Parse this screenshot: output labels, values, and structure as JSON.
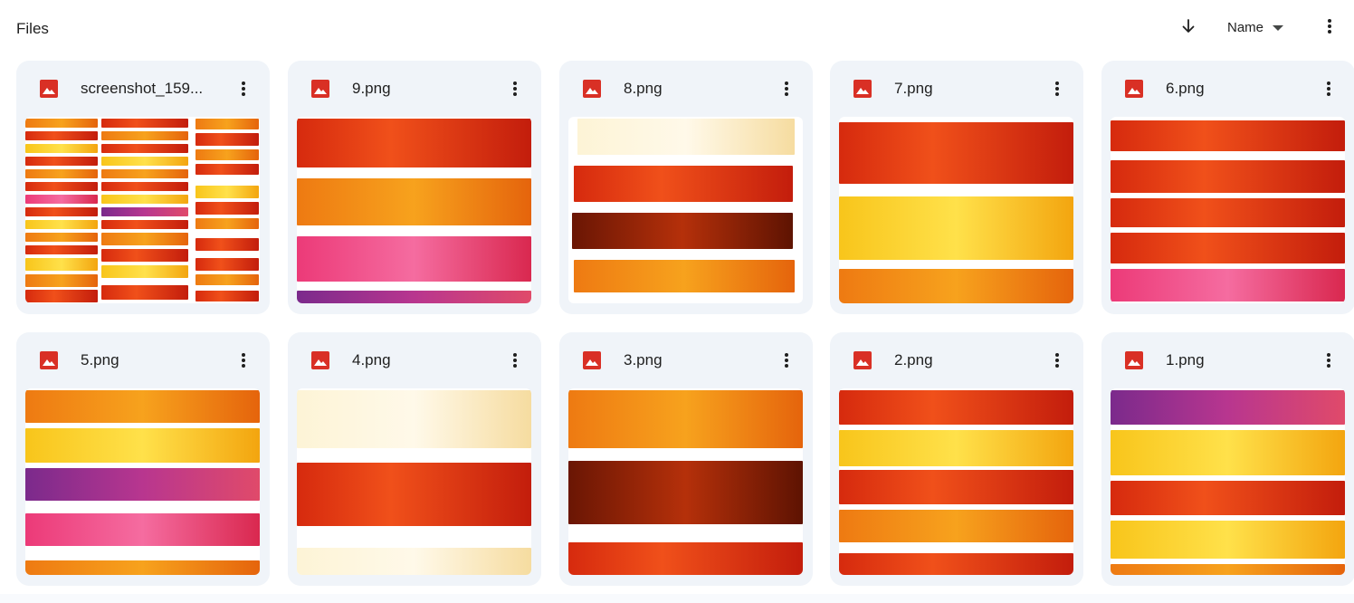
{
  "header": {
    "title": "Files",
    "sort_direction_icon": "arrow-down-icon",
    "sort_field": "Name",
    "sort_caret_icon": "caret-down-icon",
    "more_icon": "more-vert-icon"
  },
  "files": [
    {
      "name": "screenshot_159...",
      "icon": "image-file-icon"
    },
    {
      "name": "9.png",
      "icon": "image-file-icon"
    },
    {
      "name": "8.png",
      "icon": "image-file-icon"
    },
    {
      "name": "7.png",
      "icon": "image-file-icon"
    },
    {
      "name": "6.png",
      "icon": "image-file-icon"
    },
    {
      "name": "5.png",
      "icon": "image-file-icon"
    },
    {
      "name": "4.png",
      "icon": "image-file-icon"
    },
    {
      "name": "3.png",
      "icon": "image-file-icon"
    },
    {
      "name": "2.png",
      "icon": "image-file-icon"
    },
    {
      "name": "1.png",
      "icon": "image-file-icon"
    }
  ],
  "colors": {
    "card_background": "#f0f4f9",
    "image_icon": "#d93025",
    "text": "#1f1f1f",
    "icon_gray": "#444746"
  }
}
